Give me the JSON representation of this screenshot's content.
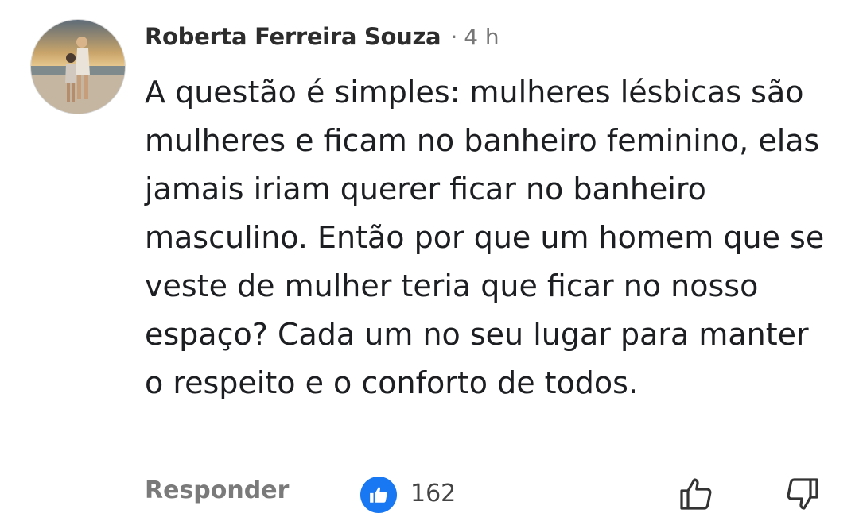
{
  "comment": {
    "author": "Roberta Ferreira Souza",
    "separator": "·",
    "time": "4 h",
    "text": "A questão é simples: mulheres lésbicas são mulheres e ficam no banheiro feminino, elas jamais iriam querer ficar no banheiro masculino. Então por que um homem que se veste de mulher teria que ficar no nosso espaço? Cada um no seu lugar para manter o respeito e o conforto de todos."
  },
  "actions": {
    "reply_label": "Responder",
    "like_count": "162",
    "like_icon": "thumbs-up-icon",
    "dislike_icon": "thumbs-down-icon"
  },
  "colors": {
    "like_badge": "#1877f2",
    "muted_text": "#777777"
  }
}
